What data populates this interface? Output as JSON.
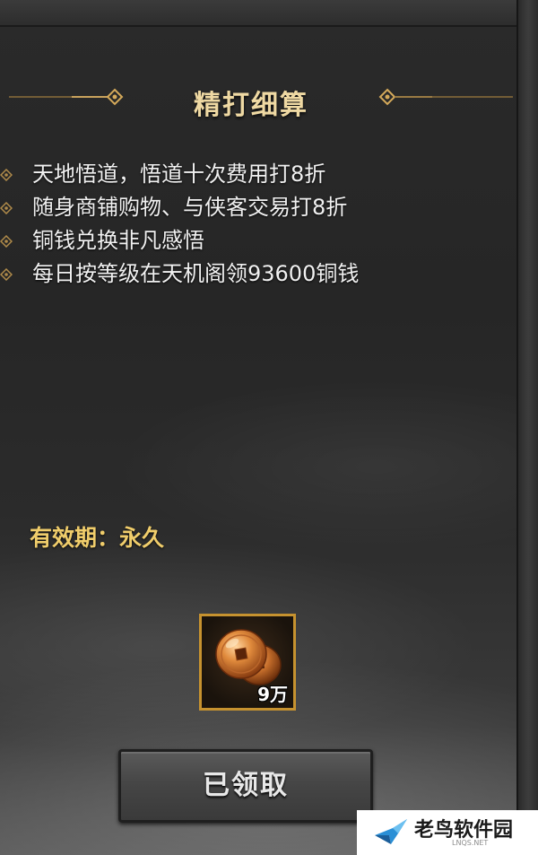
{
  "panel": {
    "title": "精打细算",
    "features": [
      "天地悟道，悟道十次费用打8折",
      "随身商铺购物、与侠客交易打8折",
      "铜钱兑换非凡感悟",
      "每日按等级在天机阁领93600铜钱"
    ],
    "validity": "有效期：永久",
    "reward": {
      "icon": "copper-coin-icon",
      "quantity": "9万"
    },
    "claim_button_label": "已领取"
  },
  "watermark": {
    "main": "老鸟软件园",
    "sub": "LNQS.NET"
  },
  "colors": {
    "title": "#efd9a3",
    "validity": "#f0cd6b",
    "slot_border": "#c6922f"
  }
}
